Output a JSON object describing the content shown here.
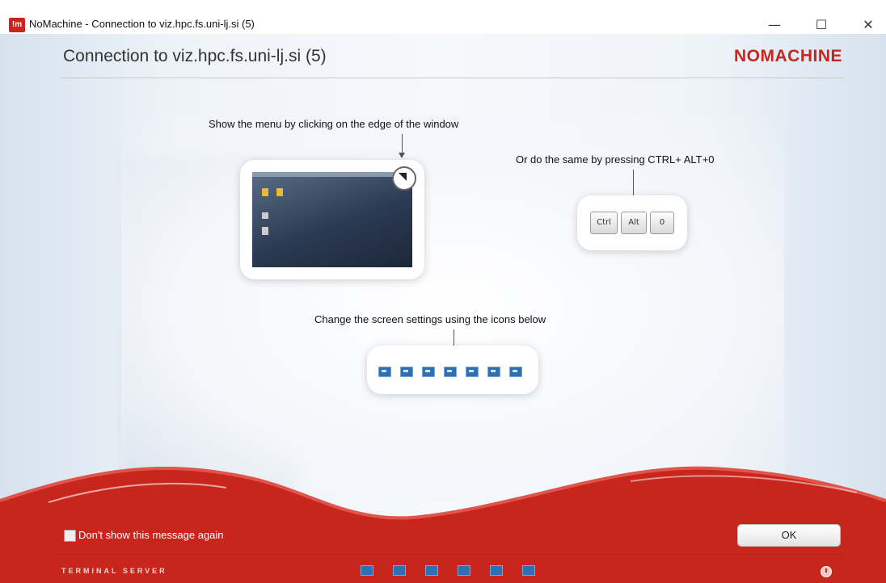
{
  "window": {
    "icon_text": "!m",
    "title": "NoMachine - Connection to viz.hpc.fs.uni-lj.si (5)",
    "minimize": "—",
    "maximize": "☐",
    "close": "✕"
  },
  "header": {
    "title": "Connection to viz.hpc.fs.uni-lj.si (5)",
    "logo": "NOMACHINE"
  },
  "hints": {
    "menu_caption": "Show the menu by clicking on the edge of the window",
    "shortcut_caption": "Or do the same by pressing CTRL+ ALT+0",
    "keys": [
      "Ctrl",
      "Alt",
      "0"
    ],
    "screen_caption": "Change the screen settings using the icons below",
    "screen_icons": [
      "fit-screen-icon",
      "scale-icon",
      "window-icon",
      "fullscreen-icon",
      "multi-monitor-icon",
      "display-icon",
      "display-settings-icon"
    ]
  },
  "footer": {
    "dont_show_label": "Don't show this message again",
    "ok_label": "OK",
    "server_label": "TERMINAL SERVER",
    "icons": [
      "scale-icon",
      "window-icon",
      "fullscreen-icon",
      "multi-monitor-icon",
      "display-icon",
      "display-settings-icon"
    ],
    "power": "power-icon"
  },
  "colors": {
    "brand_red": "#c8261c"
  }
}
